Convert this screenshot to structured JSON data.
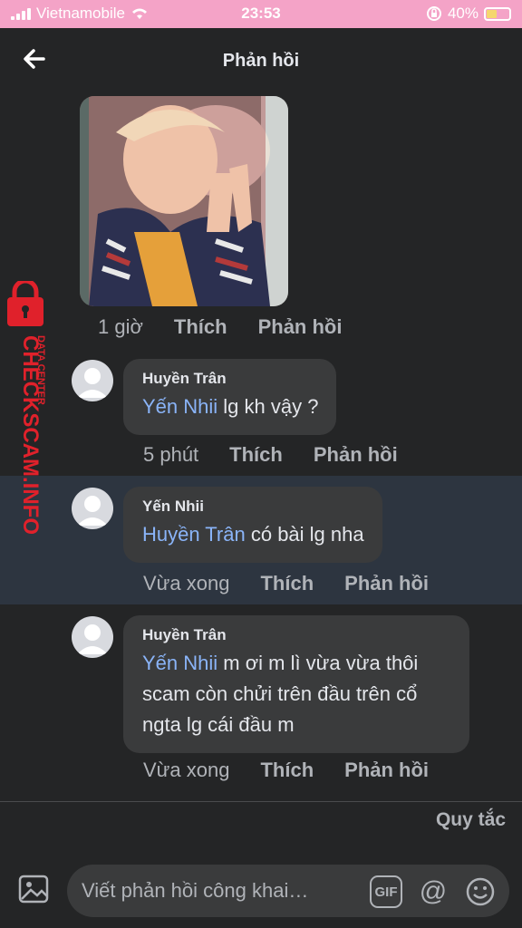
{
  "status_bar": {
    "carrier": "Vietnamobile",
    "time": "23:53",
    "battery": "40%"
  },
  "header": {
    "title": "Phản hồi",
    "back_icon": "arrow-left-icon"
  },
  "top_post": {
    "time": "1 giờ",
    "like_label": "Thích",
    "reply_label": "Phản hồi"
  },
  "comments": [
    {
      "author": "Huyền Trân",
      "mention": "Yến Nhii",
      "text_lines": [
        " lg kh vậy ?"
      ],
      "time": "5 phút",
      "like_label": "Thích",
      "reply_label": "Phản hồi",
      "highlighted": false
    },
    {
      "author": "Yến Nhii",
      "mention": "Huyền Trân",
      "text_lines": [
        " có bài lg nha"
      ],
      "time": "Vừa xong",
      "like_label": "Thích",
      "reply_label": "Phản hồi",
      "highlighted": true
    },
    {
      "author": "Huyền Trân",
      "mention": "Yến Nhii",
      "text_lines": [
        " m ơi m lì vừa vừa thôi",
        "scam còn chửi trên đầu trên cổ",
        "ngta lg cái đầu m"
      ],
      "time": "Vừa xong",
      "like_label": "Thích",
      "reply_label": "Phản hồi",
      "highlighted": false
    }
  ],
  "rules_label": "Quy tắc",
  "composer": {
    "placeholder": "Viết phản hồi công khai…",
    "gif_label": "GIF",
    "at_label": "@"
  },
  "watermark": {
    "brand": "CHECKSCAM.INFO",
    "subtitle": "DATA CENTER"
  },
  "colors": {
    "background": "#242526",
    "bubble": "#3a3b3c",
    "mention": "#8ab4f8",
    "highlight": "#2d3540",
    "status_bar": "#f4a3c7"
  }
}
